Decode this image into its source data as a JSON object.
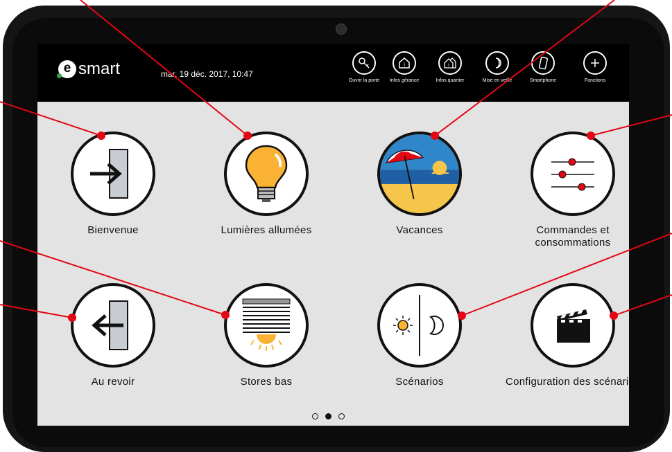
{
  "header": {
    "logo_text": "smart",
    "logo_letter": "e",
    "datetime": "mar. 19 déc. 2017, 10:47",
    "buttons": [
      {
        "label": "Ouvrir la porte",
        "icon": "key-icon"
      },
      {
        "label": "Infos gérance",
        "icon": "house-info-icon"
      },
      {
        "label": "Infos quartier",
        "icon": "houses-info-icon"
      },
      {
        "label": "Mise en veille",
        "icon": "moon-icon"
      },
      {
        "label": "Smartphone",
        "icon": "smartphone-icon"
      },
      {
        "label": "Fonctions",
        "icon": "plus-icon"
      }
    ]
  },
  "tiles": [
    {
      "label": "Bienvenue",
      "icon": "door-enter-icon"
    },
    {
      "label": "Lumières allumées",
      "icon": "light-bulb-icon"
    },
    {
      "label": "Vacances",
      "icon": "beach-umbrella-icon"
    },
    {
      "label": "Commandes et consommations",
      "icon": "sliders-icon"
    },
    {
      "label": "Au revoir",
      "icon": "door-exit-icon"
    },
    {
      "label": "Stores bas",
      "icon": "blinds-sun-icon"
    },
    {
      "label": "Scénarios",
      "icon": "sun-moon-icon"
    },
    {
      "label": "Configuration des scénarios",
      "icon": "clapperboard-icon"
    }
  ],
  "pagination": {
    "pages": 3,
    "current": 2
  },
  "colors": {
    "accent": "#e30613",
    "bulb": "#f9b233",
    "sea": "#1f6fb5",
    "sand": "#f6c64b"
  }
}
